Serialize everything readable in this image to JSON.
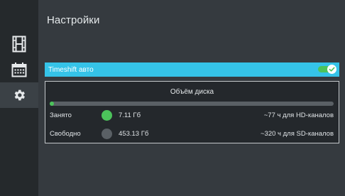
{
  "colors": {
    "accent": "#35c3e8",
    "used": "#4cc35b",
    "free": "#5a6065"
  },
  "sidebar": {
    "items": [
      {
        "icon": "film-icon"
      },
      {
        "icon": "calendar-icon"
      },
      {
        "icon": "gear-icon",
        "active": true
      }
    ]
  },
  "page": {
    "title": "Настройки"
  },
  "timeshift": {
    "label": "Timeshift авто",
    "enabled": true
  },
  "disk": {
    "title": "Объём диска",
    "used_fraction": 0.015,
    "used": {
      "label": "Занято",
      "size": "7.11 Гб",
      "hours": "~77 ч для HD-каналов"
    },
    "free": {
      "label": "Свободно",
      "size": "453.13 Гб",
      "hours": "~320 ч для SD-каналов"
    }
  }
}
